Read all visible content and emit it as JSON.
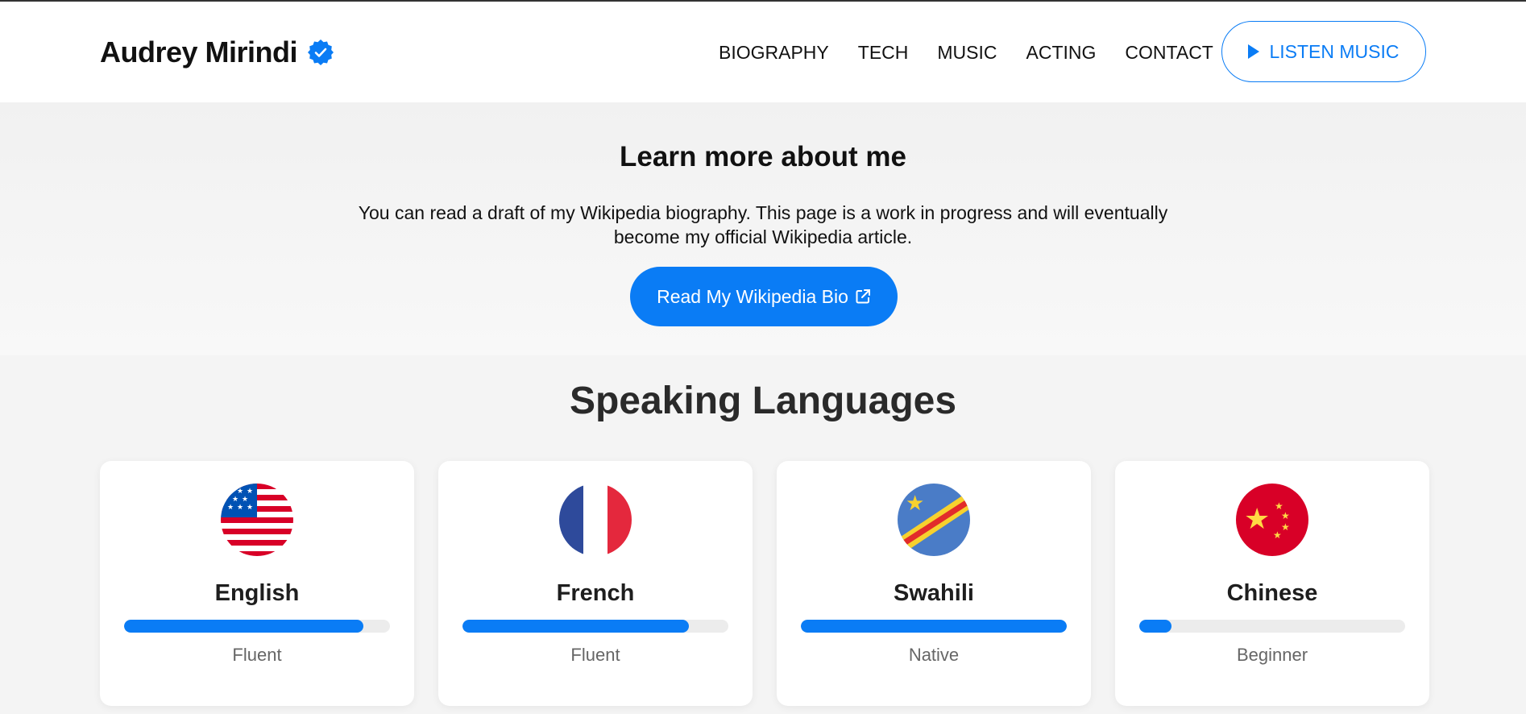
{
  "header": {
    "brand_name": "Audrey Mirindi",
    "nav": [
      "BIOGRAPHY",
      "TECH",
      "MUSIC",
      "ACTING",
      "CONTACT"
    ],
    "listen_label": "LISTEN MUSIC"
  },
  "about": {
    "title": "Learn more about me",
    "text": "You can read a draft of my Wikipedia biography. This page is a work in progress and will eventually become my official Wikipedia article.",
    "button_label": "Read My Wikipedia Bio"
  },
  "languages": {
    "title": "Speaking Languages",
    "items": [
      {
        "name": "English",
        "level": "Fluent",
        "progress": 0.9,
        "flag": "us-flag-icon"
      },
      {
        "name": "French",
        "level": "Fluent",
        "progress": 0.85,
        "flag": "france-flag-icon"
      },
      {
        "name": "Swahili",
        "level": "Native",
        "progress": 1.0,
        "flag": "drc-flag-icon"
      },
      {
        "name": "Chinese",
        "level": "Beginner",
        "progress": 0.12,
        "flag": "china-flag-icon"
      }
    ]
  },
  "colors": {
    "accent": "#0a7cf5",
    "track": "#ececec"
  }
}
